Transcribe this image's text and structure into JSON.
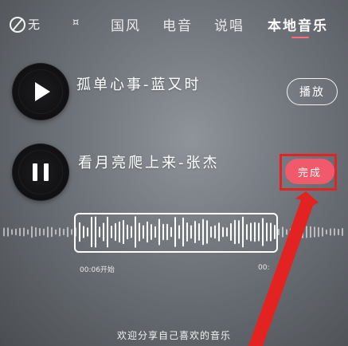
{
  "tabs": {
    "none_label": "无",
    "items": [
      "¤",
      "国风",
      "电音",
      "说唱",
      "本地音乐"
    ],
    "active_index": 4
  },
  "songs": [
    {
      "title": "孤单心事-蓝又时",
      "action_label": "播放",
      "state": "paused"
    },
    {
      "title": "看月亮爬上来-张杰",
      "action_label": "完成",
      "state": "playing"
    }
  ],
  "waveform": {
    "start_label": "00:06开始",
    "end_label": "00:"
  },
  "footer": {
    "text": "欢迎分享自己喜欢的音乐"
  },
  "colors": {
    "accent": "#f15a6b",
    "annotation": "#e32222",
    "tab_underline": "#ff6b78"
  }
}
